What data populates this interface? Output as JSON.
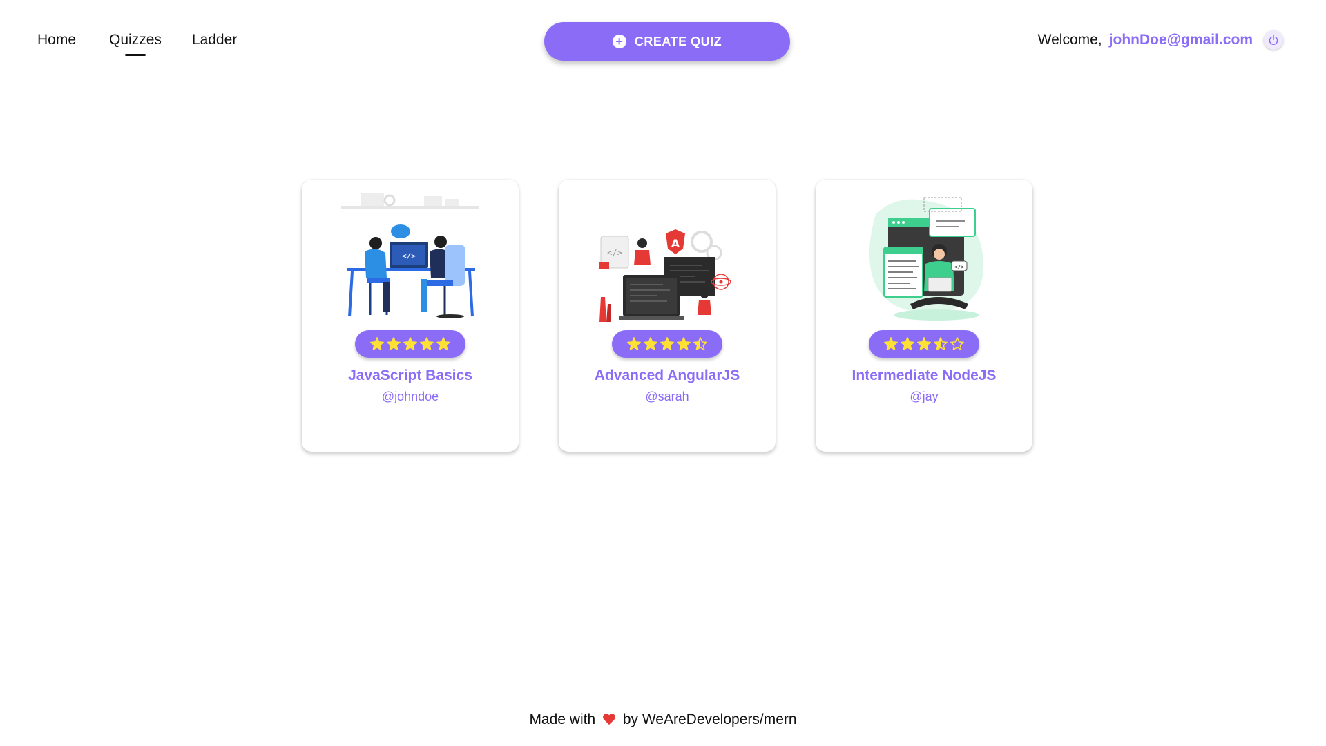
{
  "nav": {
    "items": [
      {
        "label": "Home",
        "active": false
      },
      {
        "label": "Quizzes",
        "active": true
      },
      {
        "label": "Ladder",
        "active": false
      }
    ]
  },
  "header": {
    "create_button_label": "CREATE QUIZ",
    "create_icon": "plus-circle-icon",
    "welcome_text": "Welcome,",
    "user_email": "johnDoe@gmail.com",
    "logout_icon": "power-icon"
  },
  "colors": {
    "accent": "#8b6cf7",
    "star": "#ffe135",
    "heart": "#e53935"
  },
  "quizzes": [
    {
      "title": "JavaScript Basics",
      "author": "@johndoe",
      "rating": 5,
      "image_icon": "developers-at-desk-illustration"
    },
    {
      "title": "Advanced AngularJS",
      "author": "@sarah",
      "rating": 4.5,
      "image_icon": "angular-developers-illustration"
    },
    {
      "title": "Intermediate NodeJS",
      "author": "@jay",
      "rating": 3.5,
      "image_icon": "developer-with-laptop-illustration"
    }
  ],
  "footer": {
    "prefix": "Made with",
    "heart_icon": "heart-icon",
    "suffix": "by WeAreDevelopers/mern"
  }
}
